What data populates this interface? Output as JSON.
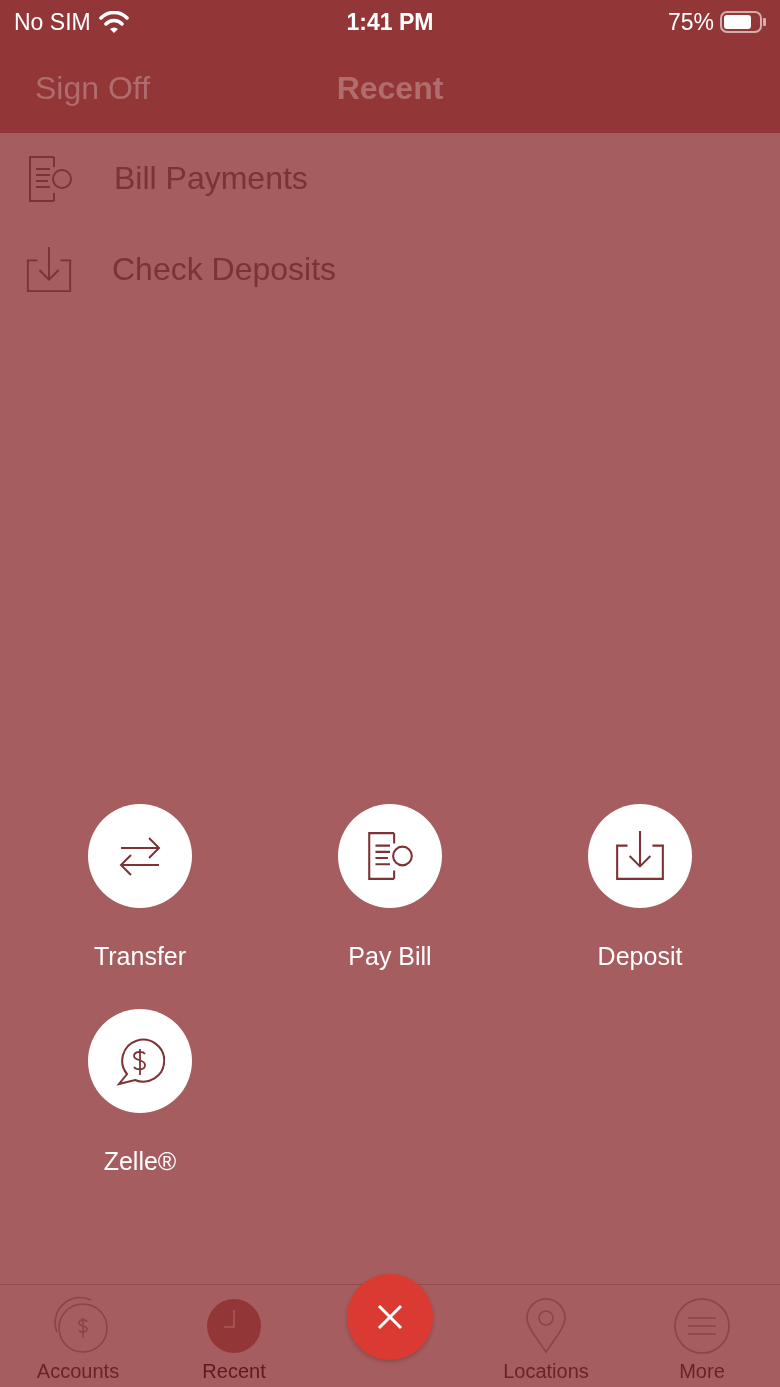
{
  "status_bar": {
    "carrier": "No SIM",
    "time": "1:41 PM",
    "battery": "75%"
  },
  "nav_bar": {
    "left_button": "Sign Off",
    "title": "Recent"
  },
  "recent_items": [
    {
      "label": "Bill Payments"
    },
    {
      "label": "Check Deposits"
    }
  ],
  "quick_actions": [
    {
      "label": "Transfer"
    },
    {
      "label": "Pay Bill"
    },
    {
      "label": "Deposit"
    },
    {
      "label": "Zelle®"
    }
  ],
  "tab_bar": {
    "tabs": [
      {
        "label": "Accounts",
        "selected": false
      },
      {
        "label": "Recent",
        "selected": true
      },
      {
        "label": "Locations",
        "selected": false
      },
      {
        "label": "More",
        "selected": false
      }
    ]
  }
}
